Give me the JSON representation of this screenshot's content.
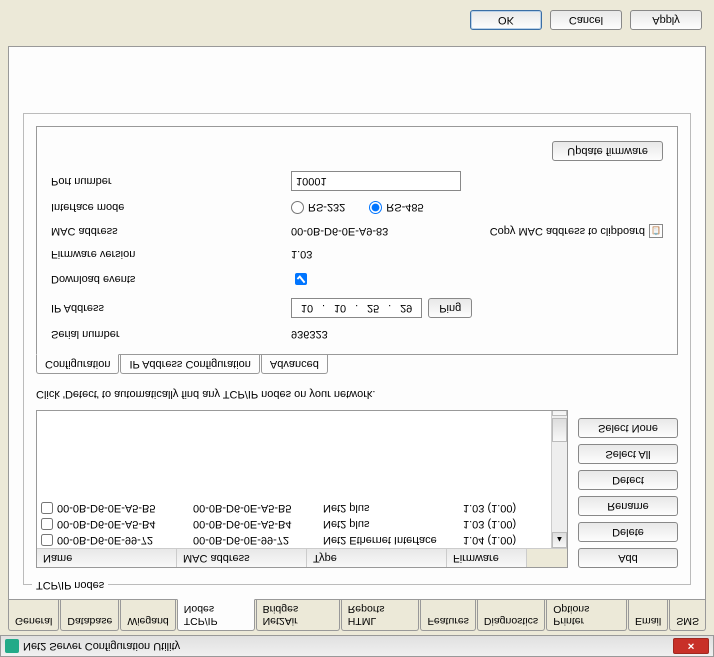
{
  "window": {
    "title": "Net2 Server Configuration Utility"
  },
  "main_tabs": [
    "General",
    "Database",
    "Wiegand",
    "TCP/IP Nodes",
    "Net2Air Bridges",
    "HTML Reports",
    "Features",
    "Diagnostics",
    "Printer Options",
    "Email",
    "SMS"
  ],
  "main_active": 3,
  "fieldset": {
    "legend": "TCP/IP nodes"
  },
  "table": {
    "headers": {
      "name": "Name",
      "mac": "MAC address",
      "type": "Type",
      "fw": "Firmware"
    },
    "rows": [
      {
        "name": "00-0B-D6-0E-99-72",
        "mac": "00-0B-D6-0E-99-72",
        "type": "Net2 Ethernet Interface",
        "fw": "1.04 (1.00)"
      },
      {
        "name": "00-0B-D6-0E-A5-B4",
        "mac": "00-0B-D6-0E-A5-B4",
        "type": "Net2 plus",
        "fw": "1.03 (1.00)"
      },
      {
        "name": "00-0B-D6-0E-A5-B5",
        "mac": "00-0B-D6-0E-A5-B5",
        "type": "Net2 plus",
        "fw": "1.03 (1.00)"
      }
    ]
  },
  "side_buttons": {
    "add": "Add",
    "delete": "Delete",
    "rename": "Rename",
    "detect": "Detect",
    "select_all": "Select All",
    "select_none": "Select None"
  },
  "hint": "Click 'Detect' to automatically find any TCP/IP nodes on your network.",
  "inner_tabs": [
    "Configuration",
    "IP Address Configuration",
    "Advanced"
  ],
  "inner_active": 0,
  "config": {
    "serial_label": "Serial number",
    "serial_value": "936323",
    "ip_label": "IP Address",
    "ip": [
      "10",
      "10",
      "25",
      "29"
    ],
    "ping": "Ping",
    "download_label": "Download events",
    "download_checked": true,
    "fw_label": "Firmware version",
    "fw_value": "1.03",
    "mac_label": "MAC address",
    "mac_value": "00-0B-D6-0E-A9-83",
    "copy_mac": "Copy MAC address to clipboard",
    "iface_label": "Interface mode",
    "rs232": "RS-232",
    "rs485": "RS-485",
    "iface_selected": "RS-485",
    "port_label": "Port number",
    "port_value": "10001",
    "update_fw": "Update firmware"
  },
  "footer": {
    "ok": "OK",
    "cancel": "Cancel",
    "apply": "Apply"
  }
}
